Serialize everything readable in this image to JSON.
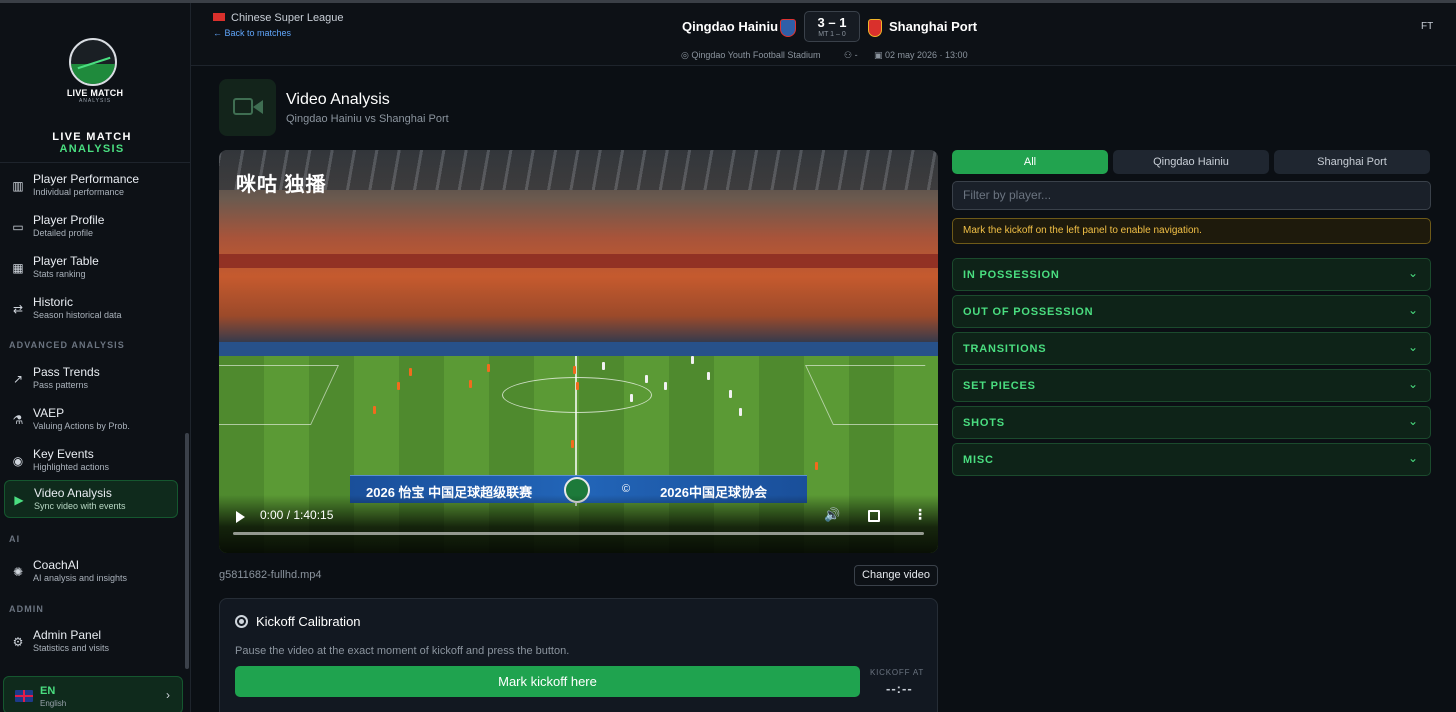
{
  "app": {
    "logo_text": "LIVE MATCH",
    "logo_subtext": "ANALYSIS",
    "brand_line1": "LIVE MATCH",
    "brand_line2": "ANALYSIS"
  },
  "sidebar": {
    "items": [
      {
        "title": "Player Performance",
        "sub": "Individual performance",
        "icon": "bar-chart-icon"
      },
      {
        "title": "Player Profile",
        "sub": "Detailed profile",
        "icon": "briefcase-icon"
      },
      {
        "title": "Player Table",
        "sub": "Stats ranking",
        "icon": "table-icon"
      },
      {
        "title": "Historic",
        "sub": "Season historical data",
        "icon": "swap-icon"
      }
    ],
    "section_advanced": "ADVANCED ANALYSIS",
    "advanced_items": [
      {
        "title": "Pass Trends",
        "sub": "Pass patterns",
        "icon": "trend-icon"
      },
      {
        "title": "VAEP",
        "sub": "Valuing Actions by Prob.",
        "icon": "flask-icon"
      },
      {
        "title": "Key Events",
        "sub": "Highlighted actions",
        "icon": "eye-icon"
      },
      {
        "title": "Video Analysis",
        "sub": "Sync video with events",
        "icon": "video-icon",
        "active": true
      }
    ],
    "section_ai": "AI",
    "ai_items": [
      {
        "title": "CoachAI",
        "sub": "AI analysis and insights",
        "icon": "lightbulb-icon"
      }
    ],
    "section_admin": "ADMIN",
    "admin_items": [
      {
        "title": "Admin Panel",
        "sub": "Statistics and visits",
        "icon": "gear-icon"
      }
    ],
    "language": {
      "code": "EN",
      "name": "English"
    }
  },
  "header": {
    "league": "Chinese Super League",
    "back_link": "← Back to matches",
    "home_team": "Qingdao Hainiu",
    "away_team": "Shanghai Port",
    "score": "3 – 1",
    "half_time": "MT 1 – 0",
    "stadium": "Qingdao Youth Football Stadium",
    "attendance": "-",
    "datetime": "02 may 2026 · 13:00",
    "status": "FT"
  },
  "main": {
    "title": "Video Analysis",
    "subtitle": "Qingdao Hainiu vs Shanghai Port",
    "video": {
      "watermark": "咪咕 独播",
      "banner_left": "2026 怡宝 中国足球超级联赛",
      "banner_right": "2026中国足球协会",
      "banner_c": "©",
      "time": "0:00 / 1:40:15",
      "progress": 0
    },
    "file_name": "g5811682-fullhd.mp4",
    "change_video": "Change video",
    "calibration": {
      "title": "Kickoff Calibration",
      "description": "Pause the video at the exact moment of kickoff and press the button.",
      "button": "Mark kickoff here",
      "kickoff_label": "KICKOFF AT",
      "kickoff_value": "--:--"
    }
  },
  "panel": {
    "tabs": [
      {
        "label": "All",
        "active": true
      },
      {
        "label": "Qingdao Hainiu",
        "active": false
      },
      {
        "label": "Shanghai Port",
        "active": false
      }
    ],
    "filter_placeholder": "Filter by player...",
    "warning": "Mark the kickoff on the left panel to enable navigation.",
    "sections": [
      "IN POSSESSION",
      "OUT OF POSSESSION",
      "TRANSITIONS",
      "SET PIECES",
      "SHOTS",
      "MISC"
    ]
  },
  "colors": {
    "accent": "#4ade80",
    "button_green": "#1fa34f",
    "background": "#0b0f14",
    "warning": "#f2c046"
  }
}
